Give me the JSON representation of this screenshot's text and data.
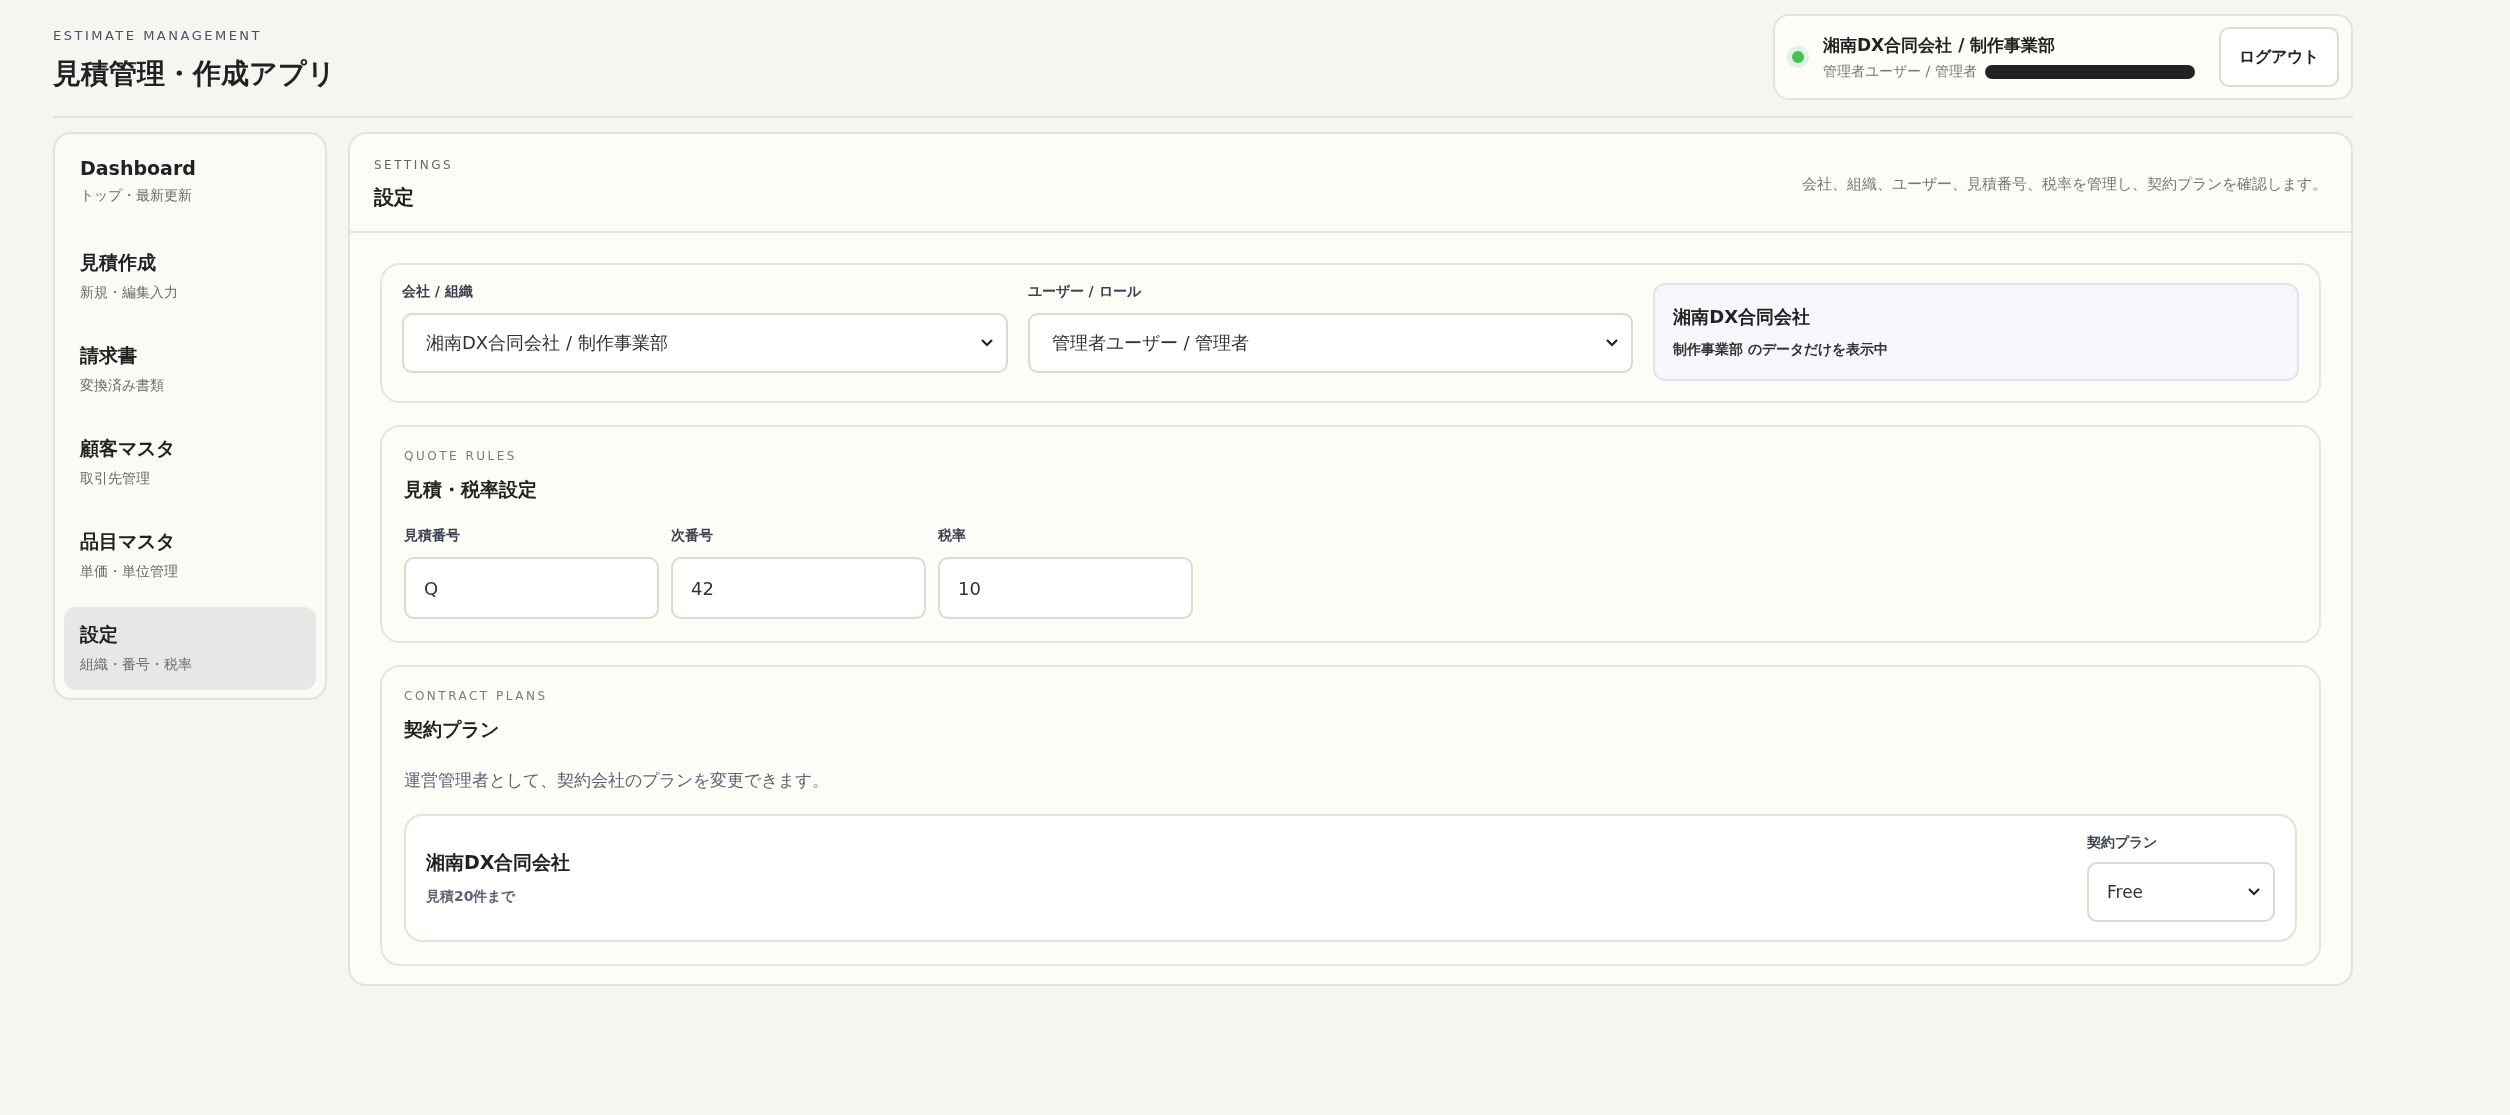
{
  "header": {
    "eyebrow": "ESTIMATE MANAGEMENT",
    "title": "見積管理・作成アプリ"
  },
  "account": {
    "online": true,
    "org": "湘南DX合同会社 / 制作事業部",
    "user": "管理者ユーザー / 管理者",
    "email_redacted": true,
    "logout": "ログアウト"
  },
  "sidebar": {
    "items": [
      {
        "label": "Dashboard",
        "sub": "トップ・最新更新",
        "selected": false
      },
      {
        "label": "見積作成",
        "sub": "新規・編集入力",
        "selected": false
      },
      {
        "label": "請求書",
        "sub": "変換済み書類",
        "selected": false
      },
      {
        "label": "顧客マスタ",
        "sub": "取引先管理",
        "selected": false
      },
      {
        "label": "品目マスタ",
        "sub": "単価・単位管理",
        "selected": false
      },
      {
        "label": "設定",
        "sub": "組織・番号・税率",
        "selected": true
      }
    ]
  },
  "settings": {
    "eyebrow": "SETTINGS",
    "title": "設定",
    "description": "会社、組織、ユーザー、見積番号、税率を管理し、契約プランを確認します。",
    "scope": {
      "company_label": "会社 / 組織",
      "company_value": "湘南DX合同会社 / 制作事業部",
      "user_label": "ユーザー / ロール",
      "user_value": "管理者ユーザー / 管理者",
      "info_title": "湘南DX合同会社",
      "info_text": "制作事業部 のデータだけを表示中"
    },
    "quote_rules": {
      "eyebrow": "QUOTE RULES",
      "title": "見積・税率設定",
      "fields": [
        {
          "label": "見積番号",
          "value": "Q"
        },
        {
          "label": "次番号",
          "value": "42"
        },
        {
          "label": "税率",
          "value": "10"
        }
      ]
    },
    "contract_plans": {
      "eyebrow": "CONTRACT PLANS",
      "title": "契約プラン",
      "description": "運営管理者として、契約会社のプランを変更できます。",
      "companies": [
        {
          "name": "湘南DX合同会社",
          "limit": "見積20件まで",
          "plan_label": "契約プラン",
          "plan": "Free"
        }
      ]
    }
  }
}
